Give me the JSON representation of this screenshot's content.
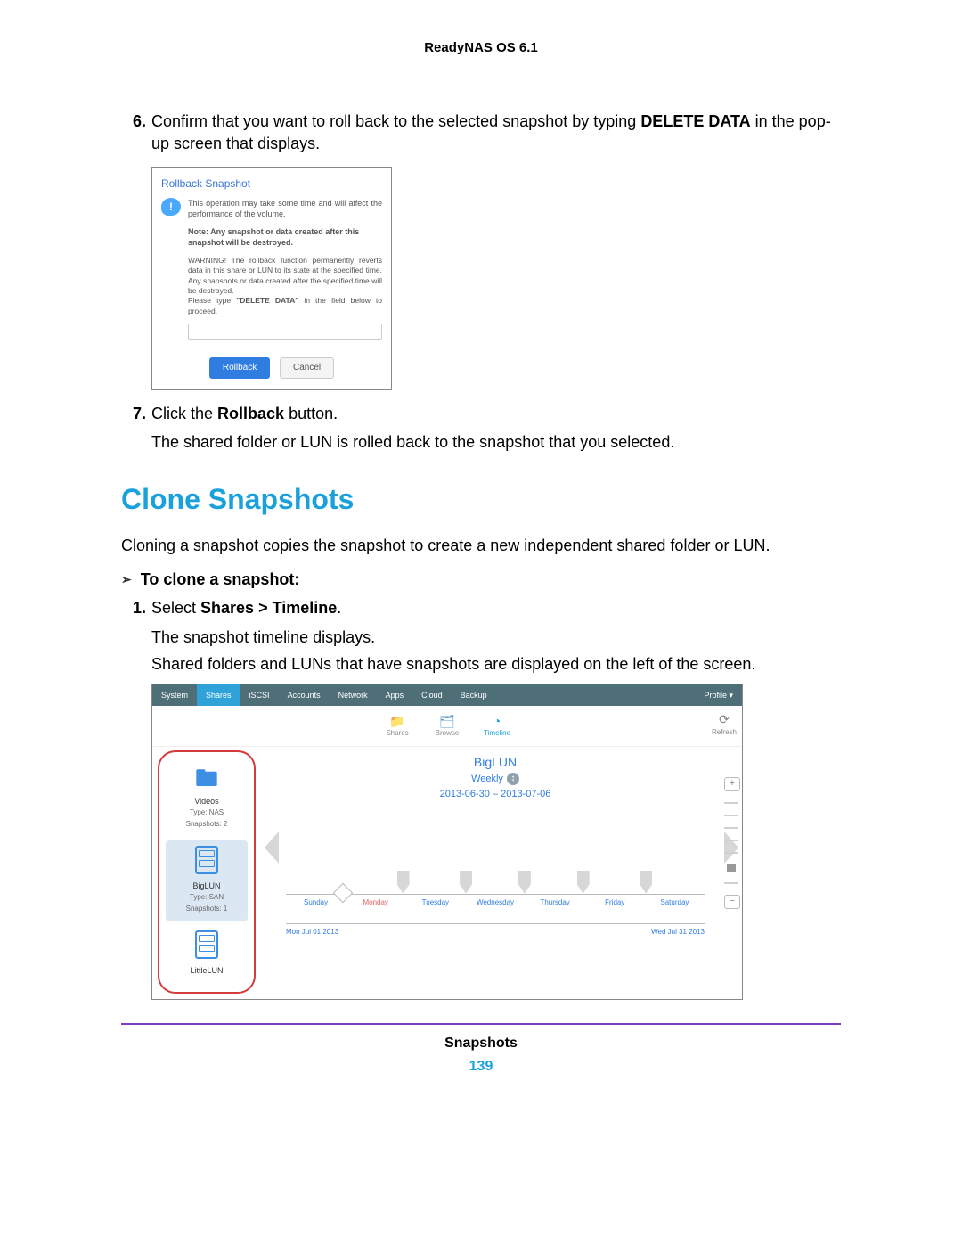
{
  "header": "ReadyNAS OS 6.1",
  "step6": {
    "num": "6.",
    "text_a": "Confirm that you want to roll back to the selected snapshot by typing ",
    "bold": "DELETE DATA",
    "text_b": " in the pop-up screen that displays."
  },
  "dialog": {
    "title": "Rollback Snapshot",
    "msg": "This operation may take some time and will affect the performance of the volume.",
    "note": "Note: Any snapshot or data created after this snapshot will be destroyed.",
    "warn1": "WARNING! The rollback function permanently reverts data in this share or LUN to its state at the specified time. Any snapshots or data created after the specified time will be destroyed.",
    "warn2a": "Please type ",
    "warn2b": "\"DELETE DATA\"",
    "warn2c": " in the field below to proceed.",
    "rollback": "Rollback",
    "cancel": "Cancel"
  },
  "step7": {
    "num": "7.",
    "text_a": "Click the ",
    "bold": "Rollback",
    "text_b": " button."
  },
  "step7_after": "The shared folder or LUN is rolled back to the snapshot that you selected.",
  "section": "Clone Snapshots",
  "intro": "Cloning a snapshot copies the snapshot to create a new independent shared folder or LUN.",
  "procedure_title": "To clone a snapshot:",
  "p1": {
    "num": "1.",
    "text_a": "Select ",
    "bold": "Shares > Timeline",
    "text_b": "."
  },
  "p1_after1": "The snapshot timeline displays.",
  "p1_after2": "Shared folders and LUNs that have snapshots are displayed on the left of the screen.",
  "timeline": {
    "tabs": [
      "System",
      "Shares",
      "iSCSI",
      "Accounts",
      "Network",
      "Apps",
      "Cloud",
      "Backup"
    ],
    "profile": "Profile ▾",
    "tools": {
      "shares": "Shares",
      "browse": "Browse",
      "timeline": "Timeline",
      "refresh": "Refresh"
    },
    "items": [
      {
        "name": "Videos",
        "type": "Type: NAS",
        "snaps": "Snapshots: 2",
        "icon": "folder"
      },
      {
        "name": "BigLUN",
        "type": "Type: SAN",
        "snaps": "Snapshots: 1",
        "icon": "db",
        "selected": true
      },
      {
        "name": "LittleLUN",
        "type": "",
        "snaps": "",
        "icon": "db"
      }
    ],
    "title": "BigLUN",
    "sub": "Weekly",
    "range": "2013-06-30 – 2013-07-06",
    "days": [
      "Sunday",
      "Monday",
      "Tuesday",
      "Wednesday",
      "Thursday",
      "Friday",
      "Saturday"
    ],
    "month_start": "Mon Jul 01 2013",
    "month_end": "Wed Jul 31 2013",
    "plus": "+",
    "minus": "−"
  },
  "footer": {
    "label": "Snapshots",
    "page": "139"
  }
}
